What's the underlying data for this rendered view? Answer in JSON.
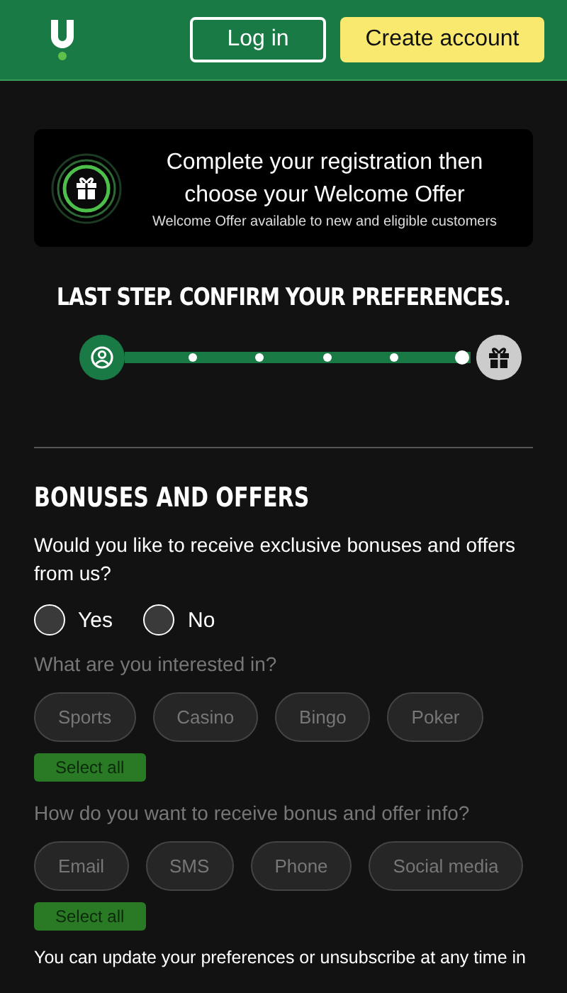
{
  "header": {
    "login": "Log in",
    "create_account": "Create account"
  },
  "banner": {
    "title": "Complete your registration then choose your Welcome Offer",
    "subtitle": "Welcome Offer available to new and eligible customers"
  },
  "progress": {
    "title": "LAST STEP. CONFIRM YOUR PREFERENCES.",
    "steps": [
      {
        "kind": "start",
        "done": true
      },
      {
        "kind": "dot",
        "done": true
      },
      {
        "kind": "dot",
        "done": true
      },
      {
        "kind": "dot",
        "done": true
      },
      {
        "kind": "dot",
        "done": true
      },
      {
        "kind": "dot",
        "done": true
      },
      {
        "kind": "gift",
        "done": false
      }
    ]
  },
  "section": {
    "title": "BONUSES AND OFFERS",
    "question": "Would you like to receive exclusive bonuses and offers from us?",
    "options": [
      {
        "label": "Yes",
        "selected": false
      },
      {
        "label": "No",
        "selected": false
      }
    ],
    "groups": [
      {
        "label": "What are you interested in?",
        "disabled": true,
        "chips": [
          {
            "label": "Sports",
            "selected": false
          },
          {
            "label": "Casino",
            "selected": false
          },
          {
            "label": "Bingo",
            "selected": false
          },
          {
            "label": "Poker",
            "selected": false
          }
        ],
        "select_all": "Select all"
      },
      {
        "label": "How do you want to receive bonus and offer info?",
        "disabled": true,
        "chips": [
          {
            "label": "Email",
            "selected": false
          },
          {
            "label": "SMS",
            "selected": false
          },
          {
            "label": "Phone",
            "selected": false
          },
          {
            "label": "Social media",
            "selected": false
          }
        ],
        "select_all": "Select all"
      }
    ],
    "footnote": "You can update your preferences or unsubscribe at any time in"
  }
}
